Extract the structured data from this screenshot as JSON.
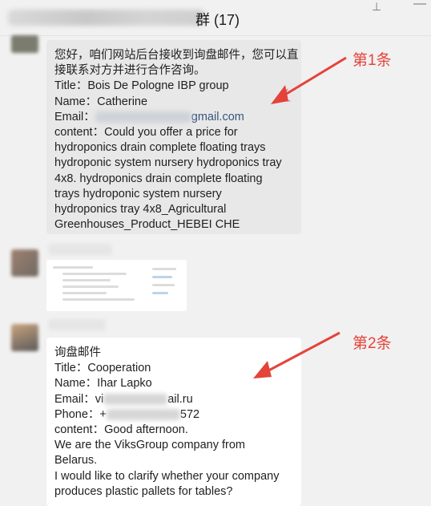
{
  "window": {
    "title_suffix": "群 (17)",
    "icons": [
      "pin-icon",
      "minimize-icon"
    ]
  },
  "messages": [
    {
      "lines": [
        "您好，咱们网站后台接收到询盘邮件，您可以直",
        "接联系对方并进行合作咨询。",
        "Title：Bois De Pologne IBP group",
        "Name：Catherine",
        "Email：",
        "content：Could you offer a price for",
        "hydroponics drain complete floating trays",
        "hydroponic system nursery hydroponics tray",
        "4x8. hydroponics drain complete floating",
        "trays hydroponic system nursery",
        "hydroponics tray 4x8_Agricultural",
        "Greenhouses_Product_HEBEI CHE"
      ],
      "email_visible": "gmail.com"
    },
    {
      "lines": [
        "询盘邮件",
        "Title：Cooperation",
        "Name：Ihar Lapko",
        "Email：vi",
        "Phone：+",
        "content：Good afternoon.",
        "We are the ViksGroup company from",
        "Belarus.",
        "I would like to clarify whether your company",
        "produces plastic pallets for tables?"
      ],
      "email_tail": "ail.ru",
      "phone_tail": "572"
    }
  ],
  "annotations": {
    "first": "第1条",
    "second": "第2条",
    "color": "#e4433a"
  }
}
